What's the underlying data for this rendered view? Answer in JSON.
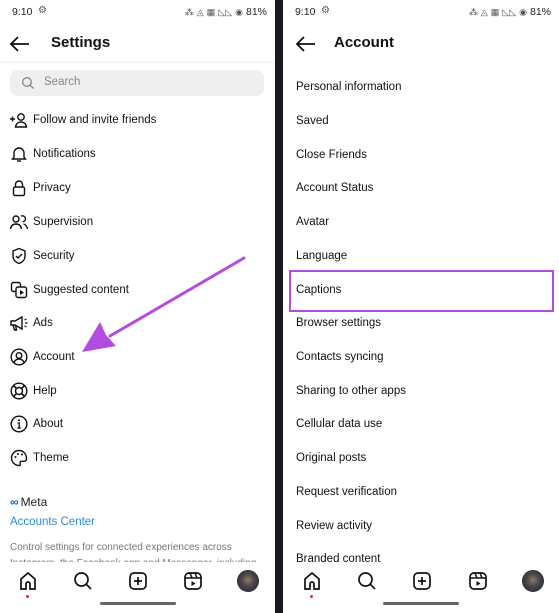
{
  "status_bar": {
    "time": "9:10",
    "battery": "81%"
  },
  "left_screen": {
    "title": "Settings",
    "search": {
      "placeholder": "Search"
    },
    "items": [
      {
        "label": "Follow and invite friends",
        "icon": "add-person-icon"
      },
      {
        "label": "Notifications",
        "icon": "bell-icon"
      },
      {
        "label": "Privacy",
        "icon": "lock-icon"
      },
      {
        "label": "Supervision",
        "icon": "people-icon"
      },
      {
        "label": "Security",
        "icon": "shield-check-icon"
      },
      {
        "label": "Suggested content",
        "icon": "suggested-content-icon"
      },
      {
        "label": "Ads",
        "icon": "megaphone-icon"
      },
      {
        "label": "Account",
        "icon": "account-circle-icon"
      },
      {
        "label": "Help",
        "icon": "lifebuoy-icon"
      },
      {
        "label": "About",
        "icon": "info-icon"
      },
      {
        "label": "Theme",
        "icon": "palette-icon"
      }
    ],
    "meta_label": "Meta",
    "accounts_center": "Accounts Center",
    "description": "Control settings for connected experiences across Instagram, the Facebook app and Messenger, including"
  },
  "right_screen": {
    "title": "Account",
    "items": [
      "Personal information",
      "Saved",
      "Close Friends",
      "Account Status",
      "Avatar",
      "Language",
      "Captions",
      "Browser settings",
      "Contacts syncing",
      "Sharing to other apps",
      "Cellular data use",
      "Original posts",
      "Request verification",
      "Review activity",
      "Branded content"
    ],
    "highlighted_item": "Captions"
  },
  "annotation": {
    "color": "#b34de0",
    "arrow_target": "Account"
  },
  "colors": {
    "accent_link": "#2a8fd0",
    "meta_blue": "#0668e1",
    "notification_dot": "#e0245e"
  }
}
